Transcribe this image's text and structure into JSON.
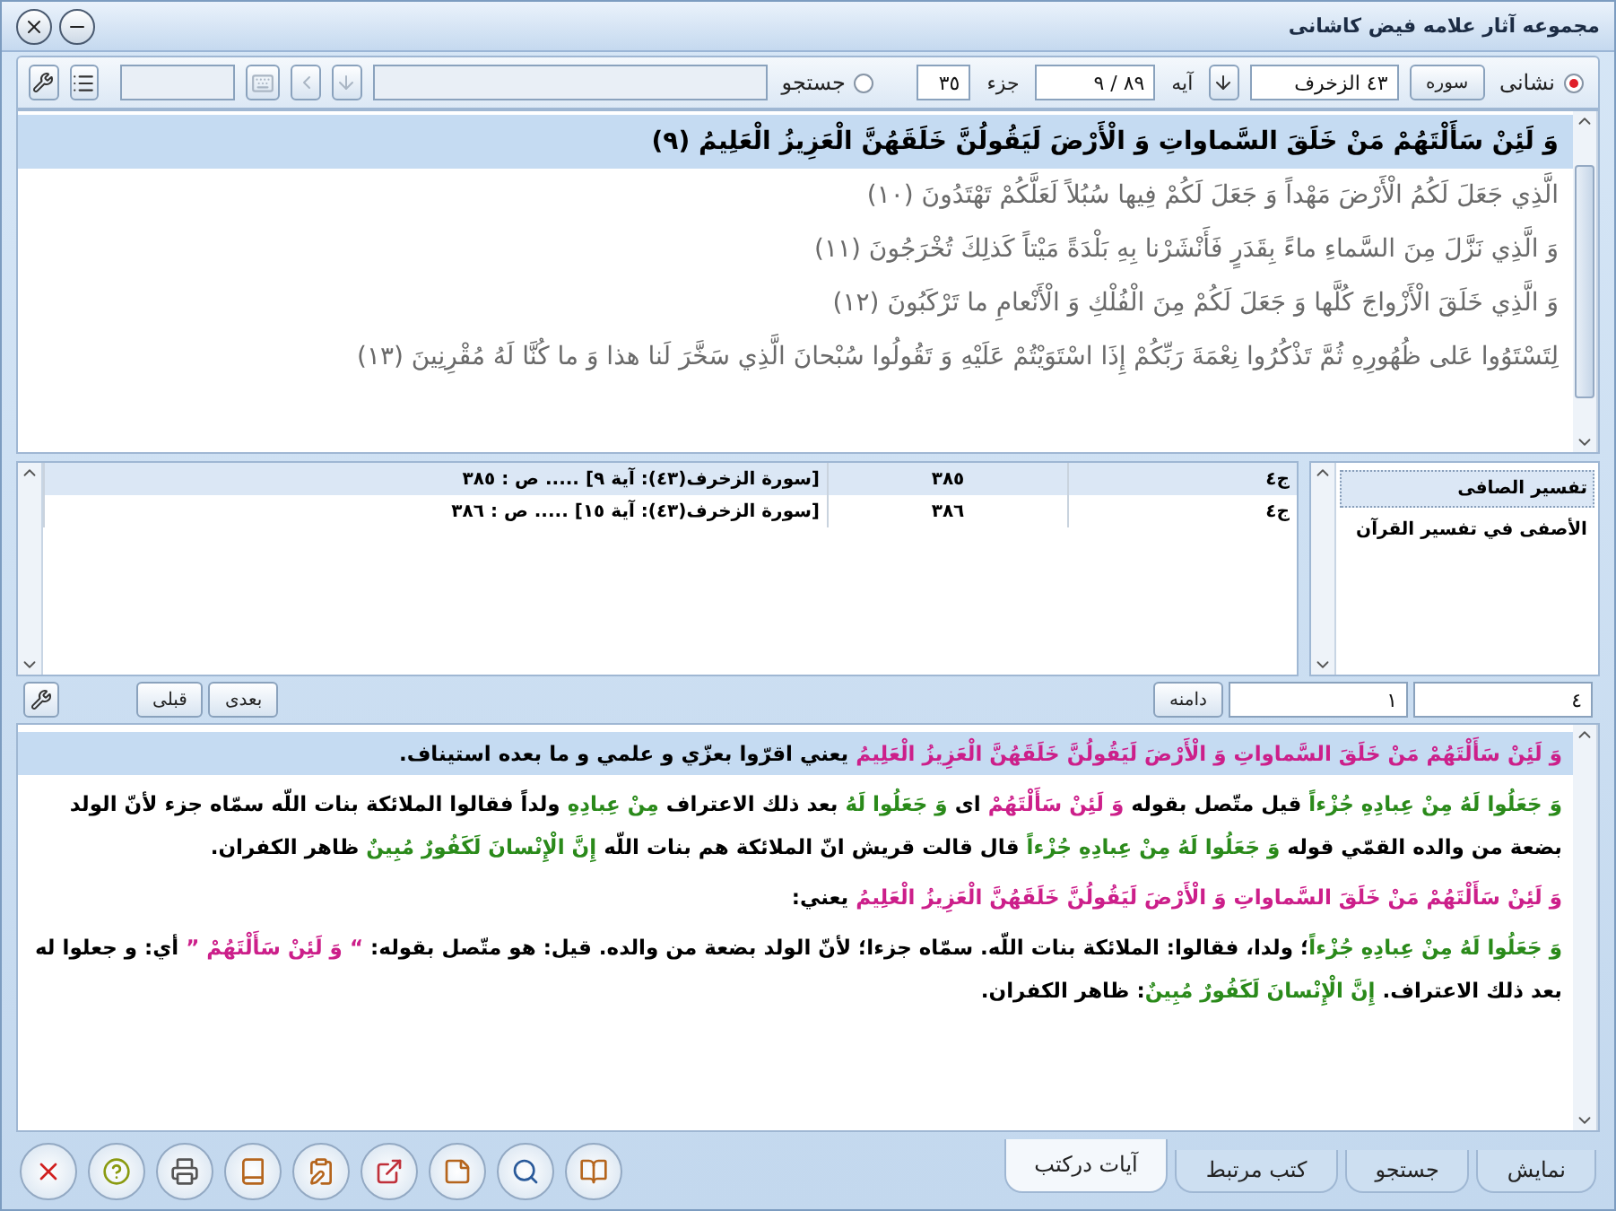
{
  "window": {
    "title": "مجموعه آثار علامه فیض کاشانی"
  },
  "toolbar": {
    "address_radio": {
      "label": "نشانی",
      "selected": true
    },
    "surah_button": "سوره",
    "surah_field": "٤٣ الزخرف",
    "verse_label": "آیه",
    "verse_field": "٨٩ / ٩",
    "juz_label": "جزء",
    "juz_field": "٣٥",
    "search_radio": {
      "label": "جستجو",
      "selected": false
    }
  },
  "verses": [
    {
      "text": "وَ لَئِنْ سَأَلْتَهُمْ مَنْ خَلَقَ السَّماواتِ وَ الْأَرْضَ لَيَقُولُنَّ خَلَقَهُنَّ الْعَزِيزُ الْعَلِيمُ (٩)",
      "selected": true
    },
    {
      "text": "الَّذِي جَعَلَ لَكُمُ الْأَرْضَ مَهْداً وَ جَعَلَ لَكُمْ فِيها سُبُلاً لَعَلَّكُمْ تَهْتَدُونَ (١٠)",
      "selected": false
    },
    {
      "text": "وَ الَّذِي نَزَّلَ مِنَ السَّماءِ ماءً بِقَدَرٍ فَأَنْشَرْنا بِهِ بَلْدَةً مَيْتاً كَذلِكَ تُخْرَجُونَ (١١)",
      "selected": false
    },
    {
      "text": "وَ الَّذِي خَلَقَ الْأَزْواجَ كُلَّها وَ جَعَلَ لَكُمْ مِنَ الْفُلْكِ وَ الْأَنْعامِ ما تَرْكَبُونَ (١٢)",
      "selected": false
    },
    {
      "text": "لِتَسْتَوُوا عَلى ظُهُورِهِ ثُمَّ تَذْكُرُوا نِعْمَةَ رَبِّكُمْ إِذَا اسْتَوَيْتُمْ عَلَيْهِ وَ تَقُولُوا سُبْحانَ الَّذِي سَخَّرَ لَنا هذا وَ ما كُنَّا لَهُ مُقْرِنِينَ (١٣)",
      "selected": false
    }
  ],
  "books": [
    {
      "label": "تفسير الصافى",
      "selected": true
    },
    {
      "label": "الأصفى في تفسير القرآن",
      "selected": false
    }
  ],
  "table": {
    "rows": [
      {
        "column_1": "ج‏٤",
        "column_2": "٣٨٥",
        "column_3": "[سورة الزخرف(٤٣): آية ٩] ..... ص : ٣٨٥",
        "selected": true
      },
      {
        "column_1": "ج‏٤",
        "column_2": "٣٨٦",
        "column_3": "[سورة الزخرف(٤٣): آية ١٥] ..... ص : ٣٨٦",
        "selected": false
      }
    ]
  },
  "range": {
    "to_field": "٤",
    "from_field": "١",
    "range_button": "دامنه",
    "next_button": "بعدی",
    "prev_button": "قبلی"
  },
  "commentary": [
    {
      "selected": true,
      "segments": [
        {
          "text": "وَ لَئِنْ سَأَلْتَهُمْ مَنْ خَلَقَ السَّماواتِ وَ الْأَرْضَ لَيَقُولُنَّ خَلَقَهُنَّ الْعَزِيزُ الْعَلِيمُ",
          "color": "#cc1f8a"
        },
        {
          "text": " يعني اقرّوا بعزّي و علمي و ما بعده استيناف.",
          "color": "#000000"
        }
      ]
    },
    {
      "selected": false,
      "segments": [
        {
          "text": "وَ جَعَلُوا لَهُ مِنْ عِبادِهِ جُزْءاً",
          "color": "#2a8a1a"
        },
        {
          "text": " قيل متّصل بقوله ",
          "color": "#000000"
        },
        {
          "text": "وَ لَئِنْ سَأَلْتَهُمْ",
          "color": "#cc1f8a"
        },
        {
          "text": " اى ",
          "color": "#000000"
        },
        {
          "text": "وَ جَعَلُوا لَهُ",
          "color": "#2a8a1a"
        },
        {
          "text": " بعد ذلك الاعتراف ",
          "color": "#000000"
        },
        {
          "text": "مِنْ عِبادِهِ",
          "color": "#2a8a1a"
        },
        {
          "text": " ولداً فقالوا الملائكة بنات اللّه سمّاه جزء لأنّ الولد بضعة من والده القمّي قوله ",
          "color": "#000000"
        },
        {
          "text": "وَ جَعَلُوا لَهُ مِنْ عِبادِهِ جُزْءاً",
          "color": "#2a8a1a"
        },
        {
          "text": " قال قالت قريش انّ الملائكة هم بنات اللّه ",
          "color": "#000000"
        },
        {
          "text": "إِنَّ الْإِنْسانَ لَكَفُورٌ مُبِينٌ",
          "color": "#2a8a1a"
        },
        {
          "text": " ظاهر الكفران.",
          "color": "#000000"
        }
      ]
    },
    {
      "selected": false,
      "segments": [
        {
          "text": "وَ لَئِنْ سَأَلْتَهُمْ مَنْ خَلَقَ السَّماواتِ وَ الْأَرْضَ لَيَقُولُنَّ خَلَقَهُنَّ الْعَزِيزُ الْعَلِيمُ",
          "color": "#cc1f8a"
        },
        {
          "text": " يعني:",
          "color": "#000000"
        }
      ]
    },
    {
      "selected": false,
      "segments": [
        {
          "text": "وَ جَعَلُوا لَهُ مِنْ عِبادِهِ جُزْءاً",
          "color": "#2a8a1a"
        },
        {
          "text": "؛ ولدا، فقالوا: الملائكة بنات اللّه. سمّاه جزءا؛ لأنّ الولد بضعة من والده. قيل: هو متّصل بقوله: ",
          "color": "#000000"
        },
        {
          "text": "“ وَ لَئِنْ سَأَلْتَهُمْ ”",
          "color": "#cc1f8a"
        },
        {
          "text": " أي: و جعلوا له بعد ذلك الاعتراف. ",
          "color": "#000000"
        },
        {
          "text": "إِنَّ الْإِنْسانَ لَكَفُورٌ مُبِينٌ",
          "color": "#2a8a1a"
        },
        {
          "text": ": ظاهر الكفران.",
          "color": "#000000"
        }
      ]
    }
  ],
  "tabs": [
    {
      "label": "نمایش",
      "selected": false
    },
    {
      "label": "جستجو",
      "selected": false
    },
    {
      "label": "کتب مرتبط",
      "selected": false
    },
    {
      "label": "آیات درکتب",
      "selected": true
    }
  ]
}
